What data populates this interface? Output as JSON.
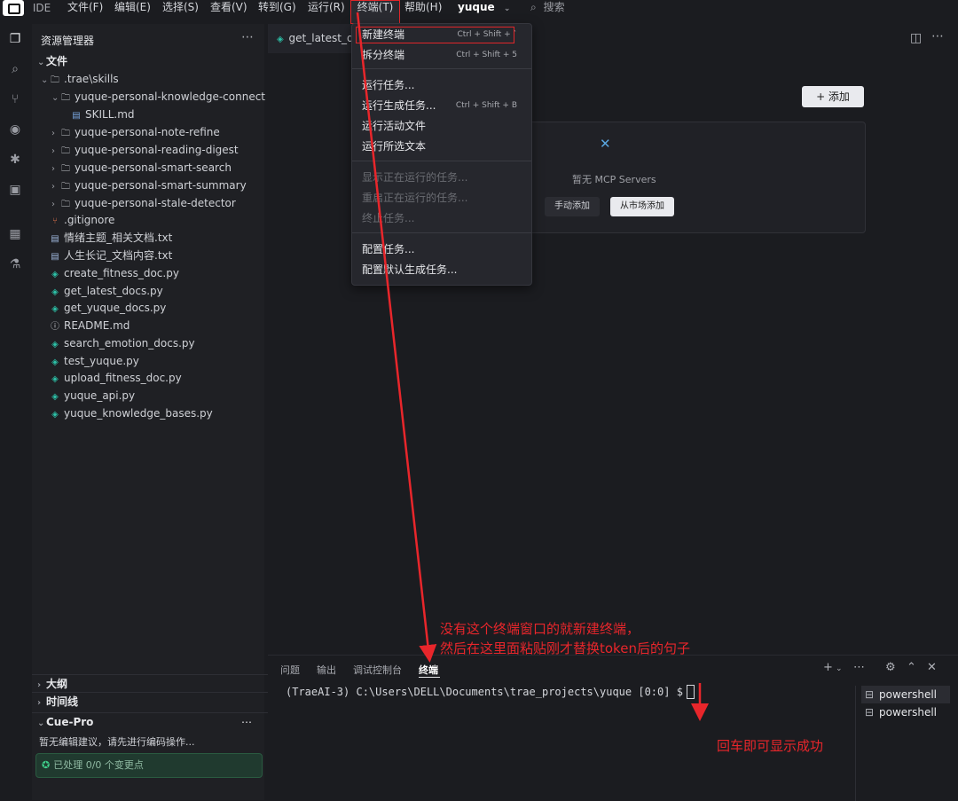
{
  "titlebar": {
    "ide_label": "IDE",
    "menus": [
      "文件(F)",
      "编辑(E)",
      "选择(S)",
      "查看(V)",
      "转到(G)",
      "运行(R)",
      "终端(T)",
      "帮助(H)"
    ],
    "workspace": "yuque",
    "search_placeholder": "搜索"
  },
  "sidebar": {
    "title": "资源管理器",
    "root": "文件",
    "items": [
      {
        "label": ".trae\\skills",
        "icon": "folder-open-icon"
      },
      {
        "label": "yuque-personal-knowledge-connect",
        "icon": "folder-open-icon"
      },
      {
        "label": "SKILL.md",
        "icon": "markdown-icon"
      },
      {
        "label": "yuque-personal-note-refine",
        "icon": "folder-icon"
      },
      {
        "label": "yuque-personal-reading-digest",
        "icon": "folder-icon"
      },
      {
        "label": "yuque-personal-smart-search",
        "icon": "folder-icon"
      },
      {
        "label": "yuque-personal-smart-summary",
        "icon": "folder-icon"
      },
      {
        "label": "yuque-personal-stale-detector",
        "icon": "folder-icon"
      },
      {
        "label": ".gitignore",
        "icon": "git-icon"
      },
      {
        "label": "情绪主题_相关文档.txt",
        "icon": "text-file-icon"
      },
      {
        "label": "人生长记_文档内容.txt",
        "icon": "text-file-icon"
      },
      {
        "label": "create_fitness_doc.py",
        "icon": "python-icon"
      },
      {
        "label": "get_latest_docs.py",
        "icon": "python-icon"
      },
      {
        "label": "get_yuque_docs.py",
        "icon": "python-icon"
      },
      {
        "label": "README.md",
        "icon": "info-icon"
      },
      {
        "label": "search_emotion_docs.py",
        "icon": "python-icon"
      },
      {
        "label": "test_yuque.py",
        "icon": "python-icon"
      },
      {
        "label": "upload_fitness_doc.py",
        "icon": "python-icon"
      },
      {
        "label": "yuque_api.py",
        "icon": "python-icon"
      },
      {
        "label": "yuque_knowledge_bases.py",
        "icon": "python-icon"
      }
    ],
    "outline": "大纲",
    "timeline": "时间线",
    "cue_title": "Cue-Pro",
    "cue_message": "暂无编辑建议，请先进行编码操作...",
    "cue_status": "已处理 0/0 个变更点"
  },
  "editor": {
    "tab_label": "get_latest_d",
    "add_button": "+ 添加",
    "mcp_empty": "暂无 MCP Servers",
    "manual_add": "手动添加",
    "market_add": "从市场添加"
  },
  "dropdown": {
    "items": [
      {
        "label": "新建终端",
        "shortcut": "Ctrl + Shift + `",
        "disabled": false
      },
      {
        "label": "拆分终端",
        "shortcut": "Ctrl + Shift + 5",
        "disabled": false
      },
      {
        "label": "运行任务...",
        "shortcut": "",
        "disabled": false
      },
      {
        "label": "运行生成任务...",
        "shortcut": "Ctrl + Shift + B",
        "disabled": false
      },
      {
        "label": "运行活动文件",
        "shortcut": "",
        "disabled": false
      },
      {
        "label": "运行所选文本",
        "shortcut": "",
        "disabled": false
      },
      {
        "label": "显示正在运行的任务...",
        "shortcut": "",
        "disabled": true
      },
      {
        "label": "重启正在运行的任务...",
        "shortcut": "",
        "disabled": true
      },
      {
        "label": "终止任务...",
        "shortcut": "",
        "disabled": true
      },
      {
        "label": "配置任务...",
        "shortcut": "",
        "disabled": false
      },
      {
        "label": "配置默认生成任务...",
        "shortcut": "",
        "disabled": false
      }
    ]
  },
  "panel": {
    "tabs": [
      "问题",
      "输出",
      "调试控制台",
      "终端"
    ],
    "active_tab": "终端",
    "terminal_line": "(TraeAI-3) C:\\Users\\DELL\\Documents\\trae_projects\\yuque [0:0] $ ",
    "terminals": [
      "powershell",
      "powershell"
    ]
  },
  "annotations": {
    "note_line1": "没有这个终端窗口的就新建终端，",
    "note_line2": "然后在这里面粘贴刚才替换token后的句子",
    "note_enter": "回车即可显示成功",
    "color": "#e8262b"
  }
}
